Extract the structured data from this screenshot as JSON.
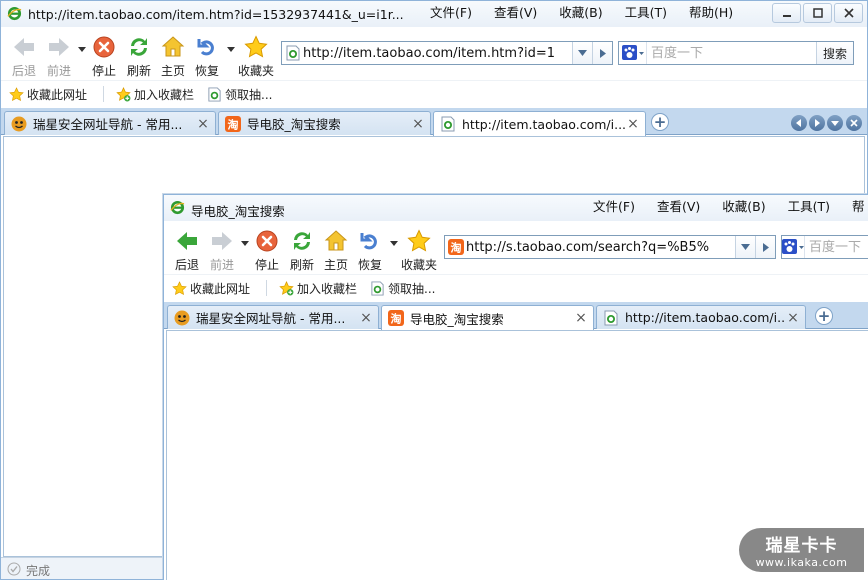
{
  "back_window": {
    "title": "http://item.taobao.com/item.htm?id=1532937441&_u=i1r...",
    "menu": [
      "文件(F)",
      "查看(V)",
      "收藏(B)",
      "工具(T)",
      "帮助(H)"
    ],
    "toolbar": {
      "back": "后退",
      "forward": "前进",
      "stop": "停止",
      "refresh": "刷新",
      "home": "主页",
      "restore": "恢复",
      "favorites": "收藏夹"
    },
    "address": "http://item.taobao.com/item.htm?id=1",
    "search": {
      "placeholder": "百度一下",
      "button": "搜索"
    },
    "favbar": [
      "收藏此网址",
      "加入收藏栏",
      "领取抽..."
    ],
    "tabs": [
      {
        "title": "瑞星安全网址导航 - 常用...",
        "active": false
      },
      {
        "title": "导电胶_淘宝搜索",
        "active": false
      },
      {
        "title": "http://item.taobao.com/i...",
        "active": true
      }
    ],
    "status": "完成"
  },
  "front_window": {
    "title": "导电胶_淘宝搜索",
    "menu": [
      "文件(F)",
      "查看(V)",
      "收藏(B)",
      "工具(T)",
      "帮"
    ],
    "toolbar": {
      "back": "后退",
      "forward": "前进",
      "stop": "停止",
      "refresh": "刷新",
      "home": "主页",
      "restore": "恢复",
      "favorites": "收藏夹"
    },
    "address": "http://s.taobao.com/search?q=%B5%",
    "search": {
      "placeholder": "百度一下"
    },
    "favbar": [
      "收藏此网址",
      "加入收藏栏",
      "领取抽..."
    ],
    "tabs": [
      {
        "title": "瑞星安全网址导航 - 常用...",
        "active": false
      },
      {
        "title": "导电胶_淘宝搜索",
        "active": true
      },
      {
        "title": "http://item.taobao.com/i...",
        "active": false
      }
    ]
  },
  "watermark": {
    "brand": "瑞星卡卡",
    "site": "www.ikaka.com"
  },
  "colors": {
    "accent": "#3c7fc8",
    "tabbar": "#c3d8ee",
    "ie_blue": "#1e6fd0"
  }
}
